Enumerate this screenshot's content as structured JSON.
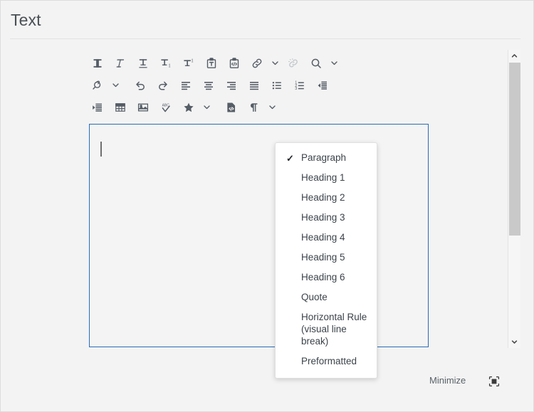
{
  "header": {
    "title": "Text"
  },
  "toolbar": {
    "rows": [
      [
        {
          "name": "bold-icon",
          "label": "Bold",
          "caret": false,
          "disabled": false
        },
        {
          "name": "italic-icon",
          "label": "Italic",
          "caret": false,
          "disabled": false
        },
        {
          "name": "underline-icon",
          "label": "Underline",
          "caret": false,
          "disabled": false
        },
        {
          "name": "subscript-icon",
          "label": "Subscript",
          "caret": false,
          "disabled": false
        },
        {
          "name": "superscript-icon",
          "label": "Superscript",
          "caret": false,
          "disabled": false
        },
        {
          "name": "paste-as-text-icon",
          "label": "Paste as text",
          "caret": false,
          "disabled": false
        },
        {
          "name": "paste-from-html-icon",
          "label": "Paste from HTML",
          "caret": false,
          "disabled": false
        },
        {
          "name": "link-icon",
          "label": "Insert/edit link",
          "caret": true,
          "disabled": false
        },
        {
          "name": "unlink-icon",
          "label": "Remove link",
          "caret": false,
          "disabled": true
        },
        {
          "name": "search-icon",
          "label": "Find and replace",
          "caret": true,
          "disabled": false
        }
      ],
      [
        {
          "name": "spellcheck-magnifier-icon",
          "label": "Spell check",
          "caret": true,
          "disabled": false
        },
        {
          "name": "undo-icon",
          "label": "Undo",
          "caret": false,
          "disabled": false
        },
        {
          "name": "redo-icon",
          "label": "Redo",
          "caret": false,
          "disabled": false
        },
        {
          "name": "align-left-icon",
          "label": "Align left",
          "caret": false,
          "disabled": false
        },
        {
          "name": "align-center-icon",
          "label": "Align center",
          "caret": false,
          "disabled": false
        },
        {
          "name": "align-right-icon",
          "label": "Align right",
          "caret": false,
          "disabled": false
        },
        {
          "name": "align-justify-icon",
          "label": "Justify",
          "caret": false,
          "disabled": false
        },
        {
          "name": "bulleted-list-icon",
          "label": "Bulleted list",
          "caret": false,
          "disabled": false
        },
        {
          "name": "numbered-list-icon",
          "label": "Numbered list",
          "caret": false,
          "disabled": false
        },
        {
          "name": "decrease-indent-icon",
          "label": "Decrease indent",
          "caret": false,
          "disabled": false
        }
      ],
      [
        {
          "name": "increase-indent-icon",
          "label": "Increase indent",
          "caret": false,
          "disabled": false
        },
        {
          "name": "table-icon",
          "label": "Table",
          "caret": false,
          "disabled": false
        },
        {
          "name": "image-icon",
          "label": "Insert image",
          "caret": false,
          "disabled": false
        },
        {
          "name": "abc-spellcheck-icon",
          "label": "Check spelling",
          "caret": false,
          "disabled": false
        },
        {
          "name": "special-character-star-icon",
          "label": "Special character",
          "caret": true,
          "disabled": false
        },
        {
          "name": "source-code-icon",
          "label": "Source code",
          "caret": false,
          "disabled": false
        },
        {
          "name": "paragraph-format-icon",
          "label": "Paragraph format",
          "caret": true,
          "disabled": false
        }
      ]
    ]
  },
  "editor": {
    "content": "",
    "placeholder": ""
  },
  "format_menu": {
    "items": [
      {
        "label": "Paragraph",
        "checked": true
      },
      {
        "label": "Heading 1",
        "checked": false
      },
      {
        "label": "Heading 2",
        "checked": false
      },
      {
        "label": "Heading 3",
        "checked": false
      },
      {
        "label": "Heading 4",
        "checked": false
      },
      {
        "label": "Heading 5",
        "checked": false
      },
      {
        "label": "Heading 6",
        "checked": false
      },
      {
        "label": "Quote",
        "checked": false
      },
      {
        "label": "Horizontal Rule (visual line break)",
        "checked": false
      },
      {
        "label": "Preformatted",
        "checked": false
      }
    ],
    "check_glyph": "✓"
  },
  "footer": {
    "minimize_label": "Minimize",
    "resize_icon": "resize-handle-icon"
  },
  "scrollbar": {
    "up_arrow": "chevron-up-icon",
    "down_arrow": "chevron-down-icon",
    "thumb": "scrollbar-thumb"
  },
  "colors": {
    "background": "#f3f3f3",
    "focus_border": "#2a6bb8",
    "icon": "#555d66",
    "text": "#3c434a"
  }
}
